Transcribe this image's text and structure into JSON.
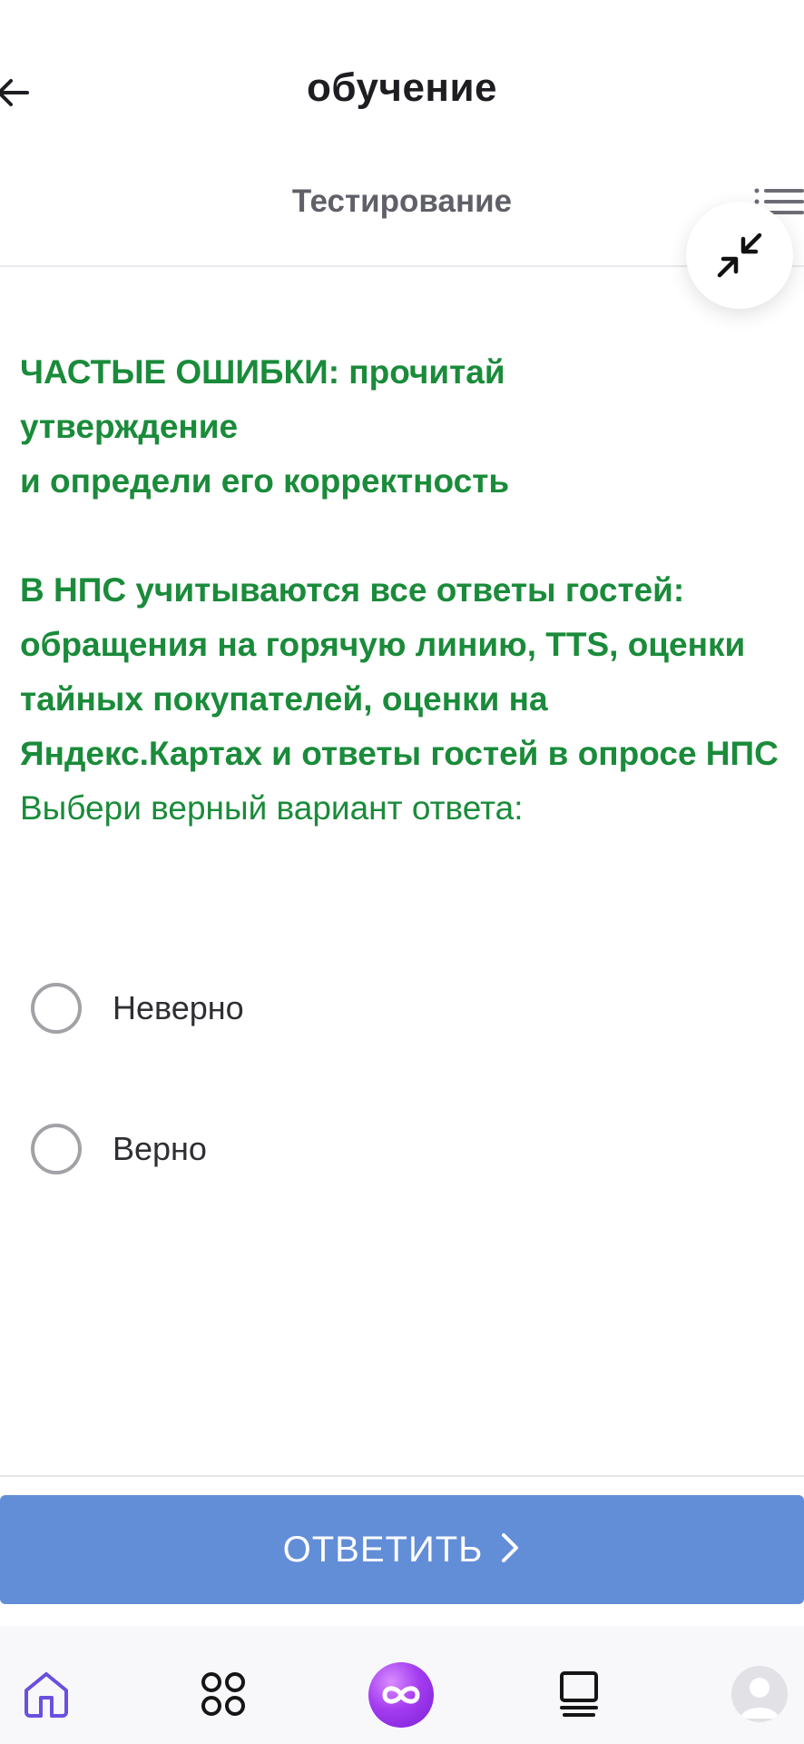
{
  "header": {
    "title": "обучение",
    "section": "Тестирование"
  },
  "question": {
    "line1": "ЧАСТЫЕ ОШИБКИ: прочитай",
    "line2": "утверждение",
    "line3": "и определи его корректность",
    "statement": "В НПС учитываются все ответы гостей: обращения на горячую линию, TTS, оценки тайных покупателей, оценки на Яндекс.Картах и ответы гостей в опросе НПС",
    "hint": "Выбери верный вариант ответа:"
  },
  "options": [
    {
      "label": "Неверно",
      "selected": false
    },
    {
      "label": "Верно",
      "selected": false
    }
  ],
  "answer_button": {
    "label": "ОТВЕТИТЬ"
  },
  "colors": {
    "question_text": "#1a8b3a",
    "answer_button": "#628ed8",
    "nav_active": "#6b4fe0",
    "center_button": "#a43cf0"
  },
  "icons": {
    "back": "arrow-left-icon",
    "menu": "list-icon",
    "collapse": "collapse-arrows-icon",
    "nav": [
      "home-icon",
      "grid-icon",
      "infinity-icon",
      "library-icon",
      "profile-avatar"
    ]
  }
}
